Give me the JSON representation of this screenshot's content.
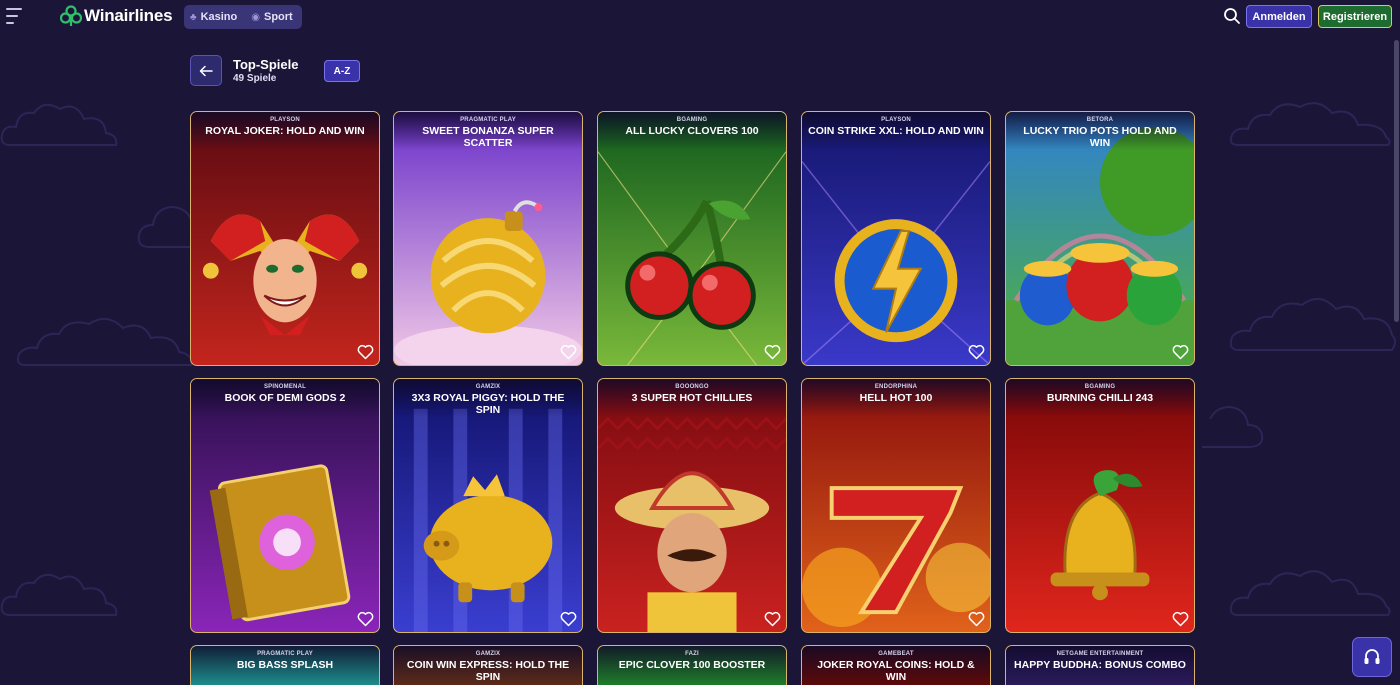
{
  "header": {
    "logo_text": "Winairlines",
    "nav": [
      {
        "label": "Kasino",
        "icon": "club-icon"
      },
      {
        "label": "Sport",
        "icon": "ball-icon"
      }
    ],
    "login_label": "Anmelden",
    "register_label": "Registrieren"
  },
  "section": {
    "title": "Top-Spiele",
    "count": "49 Spiele",
    "az_label": "A-Z"
  },
  "games": [
    {
      "provider": "PLAYSON",
      "title": "ROYAL JOKER: HOLD AND WIN",
      "theme": "joker",
      "bg1": "#5b0a12",
      "bg2": "#c3251c"
    },
    {
      "provider": "PRAGMATIC PLAY",
      "title": "SWEET BONANZA SUPER SCATTER",
      "theme": "bomb",
      "bg1": "#6a2fc9",
      "bg2": "#f1c9e6"
    },
    {
      "provider": "BGAMING",
      "title": "ALL LUCKY CLOVERS 100",
      "theme": "cherry",
      "bg1": "#0f5a1c",
      "bg2": "#79b83a"
    },
    {
      "provider": "PLAYSON",
      "title": "COIN STRIKE XXL: HOLD AND WIN",
      "theme": "coin",
      "bg1": "#14156b",
      "bg2": "#3a39c9"
    },
    {
      "provider": "BETORA",
      "title": "LUCKY TRIO POTS HOLD AND WIN",
      "theme": "pots",
      "bg1": "#2f7fd6",
      "bg2": "#4fb33a"
    },
    {
      "provider": "SPINOMENAL",
      "title": "BOOK OF DEMI GODS 2",
      "theme": "book",
      "bg1": "#2a0f4a",
      "bg2": "#8a25b8"
    },
    {
      "provider": "GAMZIX",
      "title": "3X3 ROYAL PIGGY: HOLD THE SPIN",
      "theme": "piggy",
      "bg1": "#11126b",
      "bg2": "#3a3ed0"
    },
    {
      "provider": "BOOONGO",
      "title": "3 SUPER HOT CHILLIES",
      "theme": "mexican",
      "bg1": "#7a0a10",
      "bg2": "#c9221f"
    },
    {
      "provider": "ENDORPHINA",
      "title": "HELL HOT 100",
      "theme": "seven",
      "bg1": "#8a0d0d",
      "bg2": "#e0621a"
    },
    {
      "provider": "BGAMING",
      "title": "BURNING CHILLI 243",
      "theme": "bell",
      "bg1": "#7a0608",
      "bg2": "#e0261c"
    },
    {
      "provider": "PRAGMATIC PLAY",
      "title": "BIG BASS SPLASH",
      "theme": "bass",
      "bg1": "#1d8a8a",
      "bg2": "#1d8a8a"
    },
    {
      "provider": "GAMZIX",
      "title": "COIN WIN EXPRESS: HOLD THE SPIN",
      "theme": "express",
      "bg1": "#5a2a1a",
      "bg2": "#5a2a1a"
    },
    {
      "provider": "FAZI",
      "title": "EPIC CLOVER 100 BOOSTER",
      "theme": "clover",
      "bg1": "#1f7a2a",
      "bg2": "#1f7a2a"
    },
    {
      "provider": "GAMEBEAT",
      "title": "JOKER ROYAL COINS: HOLD & WIN",
      "theme": "jcoins",
      "bg1": "#5a0a0a",
      "bg2": "#5a0a0a"
    },
    {
      "provider": "NETGAME ENTERTAINMENT",
      "title": "HAPPY BUDDHA: BONUS COMBO",
      "theme": "buddha",
      "bg1": "#2a1a5a",
      "bg2": "#2a1a5a"
    }
  ]
}
